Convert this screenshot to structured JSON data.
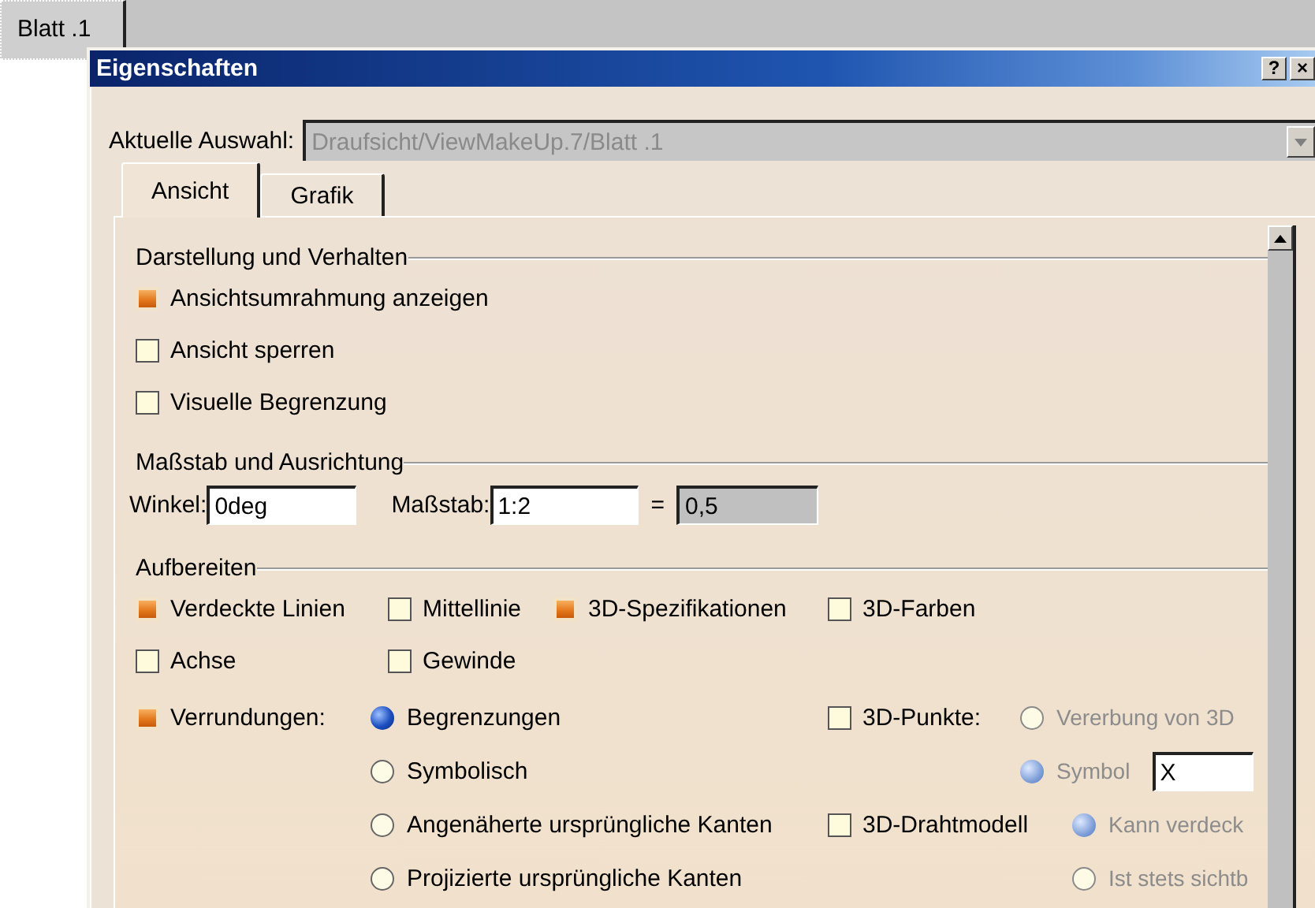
{
  "sheet_tab": {
    "label": "Blatt .1"
  },
  "dialog": {
    "title": "Eigenschaften",
    "title_buttons": [
      "?",
      "×"
    ],
    "selection": {
      "label": "Aktuelle Auswahl:",
      "value": "Draufsicht/ViewMakeUp.7/Blatt .1",
      "disabled": true
    },
    "tabs": [
      {
        "label": "Ansicht",
        "selected": true
      },
      {
        "label": "Grafik",
        "selected": false
      }
    ],
    "display": {
      "title": "Darstellung und Verhalten",
      "options": [
        {
          "label": "Ansichtsumrahmung anzeigen",
          "checked": true
        },
        {
          "label": "Ansicht sperren",
          "checked": false
        },
        {
          "label": "Visuelle Begrenzung",
          "checked": false
        }
      ]
    },
    "scale": {
      "title": "Maßstab und Ausrichtung",
      "angle": {
        "label": "Winkel:",
        "value": "0deg"
      },
      "ratio": {
        "label": "Maßstab:",
        "value": "1:2"
      },
      "equals": "=",
      "result": {
        "value": "0,5",
        "readonly": true
      }
    },
    "generate": {
      "title": "Aufbereiten",
      "rows": [
        [
          {
            "label": "Verdeckte Linien",
            "checked": true
          },
          {
            "label": "Mittellinie",
            "checked": false
          },
          {
            "label": "3D-Spezifikationen",
            "checked": true
          },
          {
            "label": "3D-Farben",
            "checked": false
          }
        ],
        [
          {
            "label": "Achse",
            "checked": false
          },
          {
            "label": "Gewinde",
            "checked": false
          }
        ]
      ],
      "fillets": {
        "label": "Verrundungen:",
        "checked": true,
        "modes": [
          {
            "label": "Begrenzungen",
            "selected": true,
            "disabled": false
          },
          {
            "label": "Symbolisch",
            "selected": false,
            "disabled": false
          },
          {
            "label": "Angenäherte ursprüngliche Kanten",
            "selected": false,
            "disabled": false
          },
          {
            "label": "Projizierte ursprüngliche Kanten",
            "selected": false,
            "disabled": false
          }
        ]
      },
      "points": {
        "label": "3D-Punkte:",
        "checked": false,
        "modes": [
          {
            "label": "Vererbung von 3D",
            "selected": false,
            "disabled": true
          },
          {
            "label": "Symbol",
            "selected": true,
            "disabled": true
          }
        ],
        "symbol": "X"
      },
      "wireframe": {
        "label": "3D-Drahtmodell",
        "checked": false,
        "modes": [
          {
            "label": "Kann verdeck",
            "selected": true,
            "disabled": true
          },
          {
            "label": "Ist stets sichtb",
            "selected": false,
            "disabled": true
          }
        ]
      }
    }
  }
}
